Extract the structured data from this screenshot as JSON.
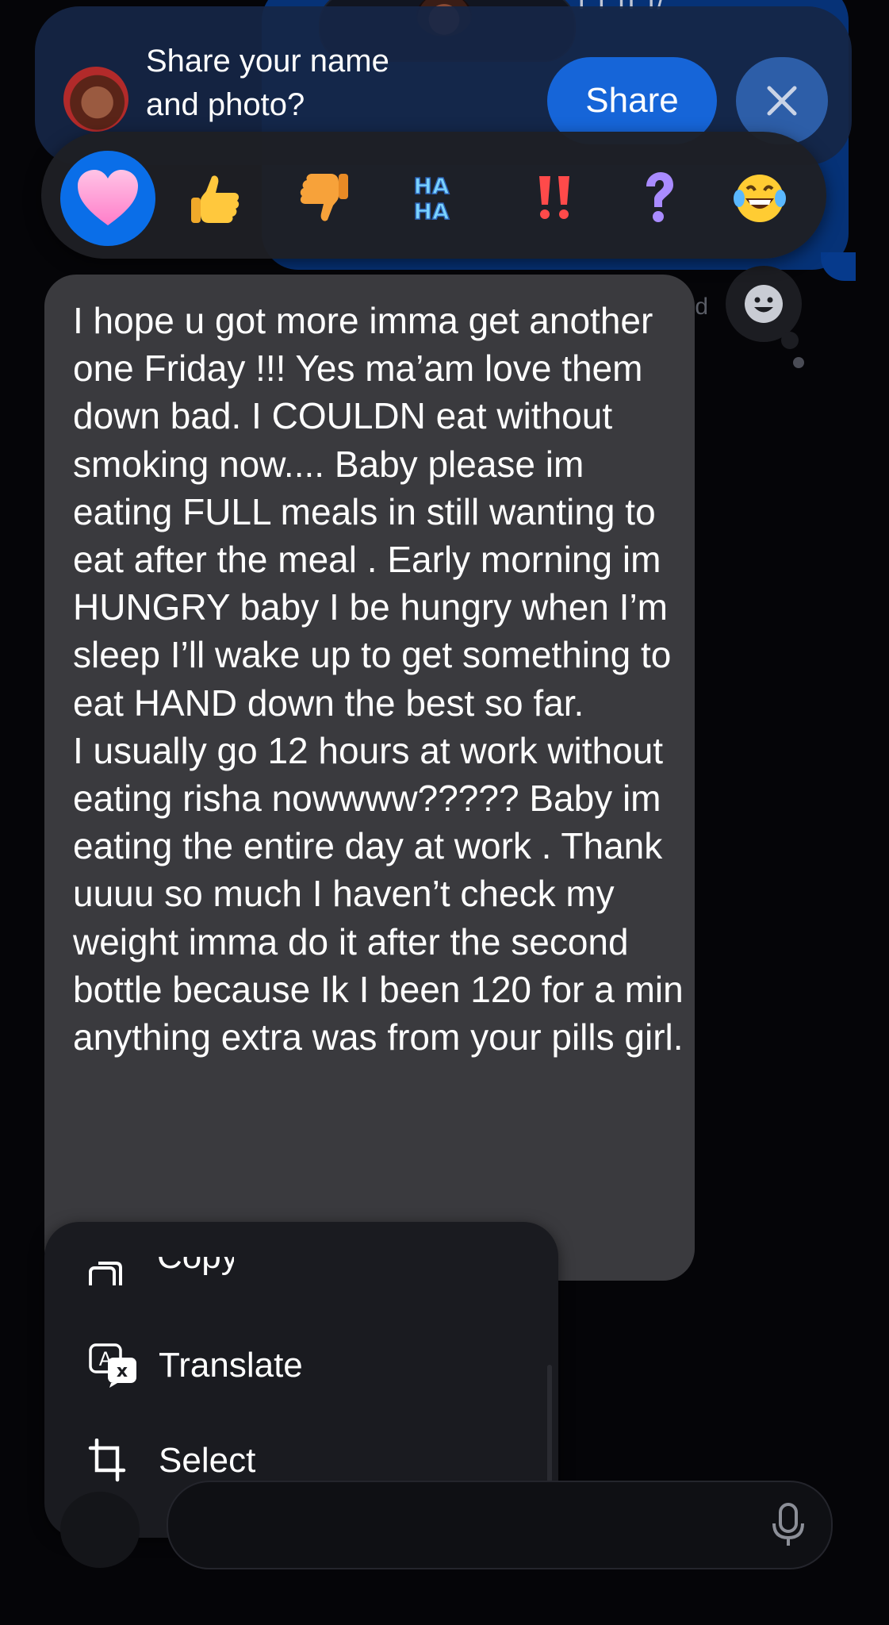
{
  "background": {
    "top_text": "ı ı ıı ı/"
  },
  "share_banner": {
    "prompt_line1": "Share your name",
    "prompt_line2": "and photo?",
    "share_label": "Share",
    "close_icon": "close-icon"
  },
  "reactions": [
    {
      "name": "heart",
      "glyph": "♥",
      "selected": true
    },
    {
      "name": "thumbs-up",
      "glyph": "👍",
      "selected": false
    },
    {
      "name": "thumbs-down",
      "glyph": "👎",
      "selected": false
    },
    {
      "name": "haha",
      "glyph": "HA HA",
      "selected": false
    },
    {
      "name": "exclamation",
      "glyph": "‼",
      "selected": false
    },
    {
      "name": "question",
      "glyph": "?",
      "selected": false
    },
    {
      "name": "laughing",
      "glyph": "😂",
      "selected": false
    }
  ],
  "faded_label": "ıd",
  "message": {
    "text": "I hope u got more imma get another one Friday !!! Yes ma’am love them down bad. I COULDN eat without smoking now.... Baby please im eating FULL meals in still wanting to eat after the meal . Early morning im HUNGRY baby I be hungry when I’m sleep I’ll wake up to get something to eat HAND down the best so far.\nI usually go 12 hours at work without eating risha nowwww????? Baby im eating the entire day at work . Thank uuuu so much I haven’t check my weight imma do it after the second bottle because Ik I been 120 for a min anything extra was from your pills girl."
  },
  "context_menu": {
    "items": [
      {
        "label": "Copy",
        "icon": "copy-icon"
      },
      {
        "label": "Translate",
        "icon": "translate-icon"
      },
      {
        "label": "Select",
        "icon": "crop-icon"
      }
    ]
  },
  "colors": {
    "accent": "#0a6ee8",
    "bubble": "#3a3a3e",
    "menu": "#1a1b20"
  }
}
